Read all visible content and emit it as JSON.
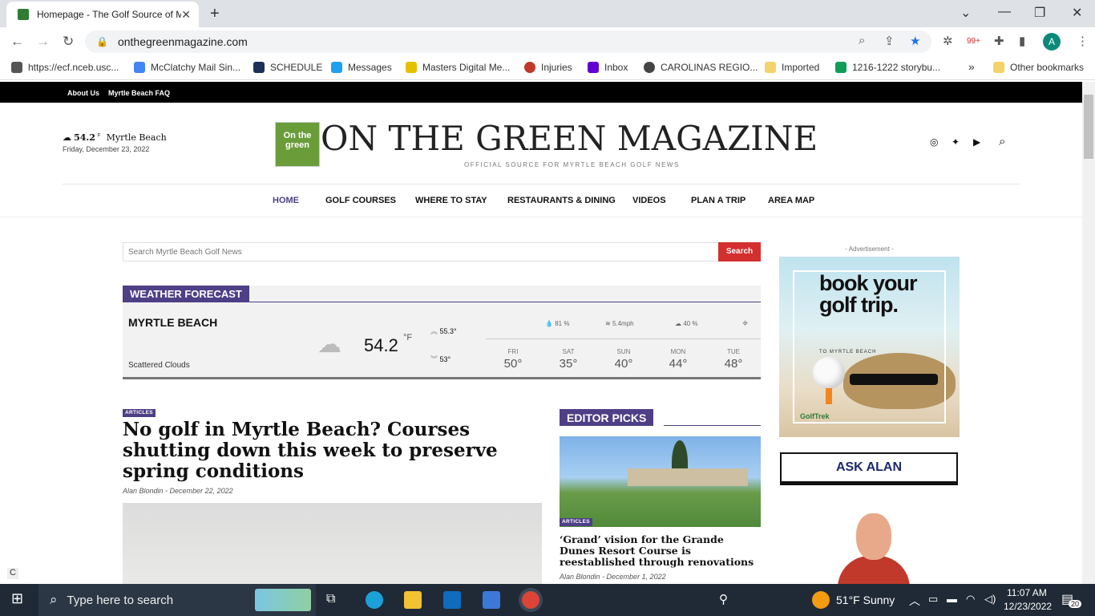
{
  "browser": {
    "tab_title": "Homepage - The Golf Source of Myrtle Beach",
    "url": "onthegreenmagazine.com",
    "bookmarks": [
      "https://ecf.nceb.usc...",
      "McClatchy Mail Sin...",
      "SCHEDULE",
      "Messages",
      "Masters Digital Me...",
      "Injuries",
      "Inbox",
      "CAROLINAS REGIO...",
      "Imported",
      "1216-1222 storybu...",
      "Other bookmarks"
    ],
    "bookmark_overflow": "»",
    "ext_badge": "99+",
    "avatar": "A"
  },
  "site": {
    "top_links": [
      "About Us",
      "Myrtle Beach FAQ"
    ],
    "weather_small": {
      "temp": "54.2",
      "unit": "F",
      "city": "Myrtle Beach",
      "date": "Friday, December 23, 2022"
    },
    "logo_text": "On the green",
    "title": "ON THE GREEN MAGAZINE",
    "tagline": "OFFICIAL SOURCE FOR MYRTLE BEACH GOLF NEWS",
    "nav": [
      "HOME",
      "GOLF COURSES",
      "WHERE TO STAY",
      "RESTAURANTS & DINING",
      "VIDEOS",
      "PLAN A TRIP",
      "AREA MAP"
    ],
    "search_placeholder": "Search Myrtle Beach Golf News",
    "search_button": "Search"
  },
  "weather": {
    "heading": "WEATHER FORECAST",
    "city": "MYRTLE BEACH",
    "condition": "Scattered Clouds",
    "temp": "54.2",
    "unit": "°F",
    "high": "55.3°",
    "low": "53°",
    "humidity": "81 %",
    "wind": "5.4mph",
    "clouds": "40 %",
    "forecast": [
      {
        "day": "FRI",
        "temp": "50°"
      },
      {
        "day": "SAT",
        "temp": "35°"
      },
      {
        "day": "SUN",
        "temp": "40°"
      },
      {
        "day": "MON",
        "temp": "44°"
      },
      {
        "day": "TUE",
        "temp": "48°"
      }
    ]
  },
  "article": {
    "tag": "ARTICLES",
    "headline": "No golf in Myrtle Beach? Courses shutting down this week to preserve spring conditions",
    "author": "Alan Blondin",
    "date": "December 22, 2022"
  },
  "editor_picks": {
    "heading": "EDITOR PICKS",
    "tag": "ARTICLES",
    "title": "‘Grand’ vision for the Grande Dunes Resort Course is reestablished through renovations",
    "author": "Alan Blondin",
    "date": "December 1, 2022"
  },
  "sidebar": {
    "ad_label": "- Advertisement -",
    "ad_headline": "book your golf trip.",
    "ad_sub": "TO MYRTLE BEACH",
    "ad_brand": "GolfTrek",
    "ask_alan": "ASK ALAN"
  },
  "taskbar": {
    "search_placeholder": "Type here to search",
    "weather": "51°F  Sunny",
    "time": "11:07 AM",
    "date": "12/23/2022",
    "notifications": "20"
  }
}
